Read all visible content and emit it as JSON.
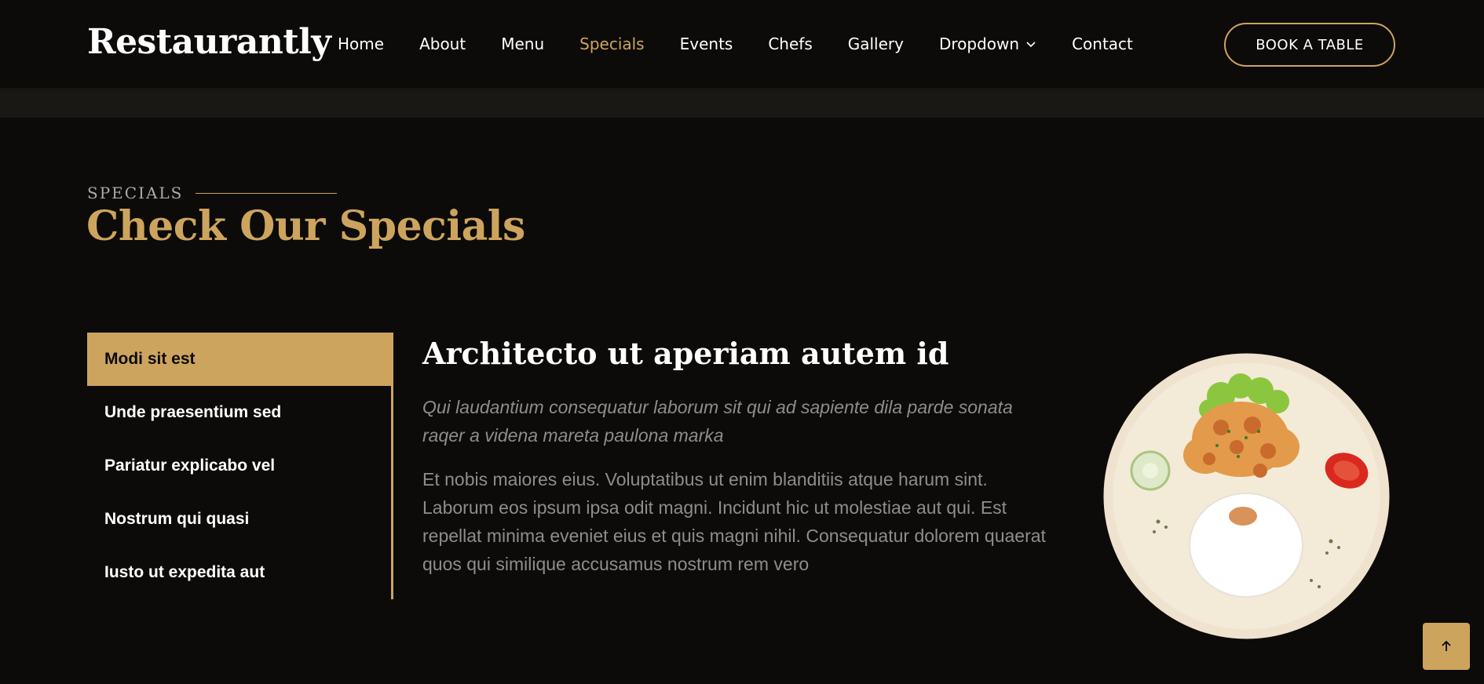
{
  "header": {
    "logo": "Restaurantly",
    "nav": [
      {
        "label": "Home"
      },
      {
        "label": "About"
      },
      {
        "label": "Menu"
      },
      {
        "label": "Specials",
        "active": true
      },
      {
        "label": "Events"
      },
      {
        "label": "Chefs"
      },
      {
        "label": "Gallery"
      },
      {
        "label": "Dropdown"
      },
      {
        "label": "Contact"
      }
    ],
    "book_button": "BOOK A TABLE"
  },
  "section": {
    "label": "SPECIALS",
    "title": "Check Our Specials"
  },
  "tabs": [
    {
      "label": "Modi sit est",
      "active": true
    },
    {
      "label": "Unde praesentium sed"
    },
    {
      "label": "Pariatur explicabo vel"
    },
    {
      "label": "Nostrum qui quasi"
    },
    {
      "label": "Iusto ut expedita aut"
    }
  ],
  "content": {
    "title": "Architecto ut aperiam autem id",
    "lead": "Qui laudantium consequatur laborum sit qui ad sapiente dila parde sonata raqer a videna mareta paulona marka",
    "body": "Et nobis maiores eius. Voluptatibus ut enim blanditiis atque harum sint. Laborum eos ipsum ipsa odit magni. Incidunt hic ut molestiae aut qui. Est repellat minima eveniet eius et quis magni nihil. Consequatur dolorem quaerat quos qui similique accusamus nostrum rem vero"
  },
  "colors": {
    "accent": "#cda45e",
    "background": "#0c0b09",
    "muted_text": "#8f8d89"
  },
  "icons": {
    "dropdown": "chevron-down-icon",
    "back_to_top": "arrow-up-icon"
  }
}
